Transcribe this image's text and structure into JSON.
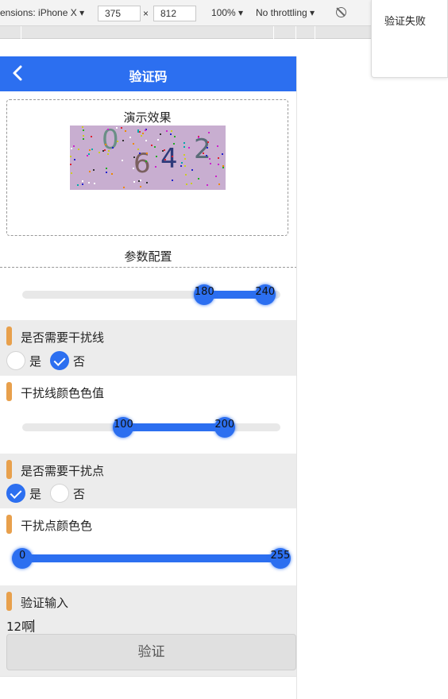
{
  "devtools": {
    "device_label": "ensions: iPhone X ▾",
    "width": "375",
    "times": "×",
    "height": "812",
    "zoom": "100% ▾",
    "throttling": "No throttling ▾"
  },
  "toast": {
    "message": "验证失败"
  },
  "navbar": {
    "title": "验证码",
    "back_icon": "chevron-left-icon"
  },
  "demo": {
    "title": "演示效果",
    "captcha_chars": [
      "0",
      "6",
      "4",
      "2"
    ]
  },
  "params": {
    "title": "参数配置",
    "bg_slider": {
      "min": 0,
      "max": 255,
      "low": 180,
      "high": 240,
      "low_label": "180",
      "high_label": "240"
    },
    "line_toggle": {
      "label": "是否需要干扰线",
      "yes": "是",
      "no": "否",
      "selected": "no"
    },
    "line_color": {
      "label": "干扰线颜色色值",
      "slider": {
        "min": 0,
        "max": 255,
        "low": 100,
        "high": 200,
        "low_label": "100",
        "high_label": "200"
      }
    },
    "dot_toggle": {
      "label": "是否需要干扰点",
      "yes": "是",
      "no": "否",
      "selected": "yes"
    },
    "dot_color": {
      "label": "干扰点颜色色",
      "slider": {
        "min": 0,
        "max": 255,
        "low": 0,
        "high": 255,
        "low_label": "0",
        "high_label": "255"
      }
    },
    "verify_input": {
      "label": "验证输入",
      "value": "12啊"
    },
    "verify_button": "验证"
  },
  "colors": {
    "primary": "#2c6ff0",
    "accent_bar": "#e8a04c",
    "captcha_bg": "#c8aed0"
  }
}
